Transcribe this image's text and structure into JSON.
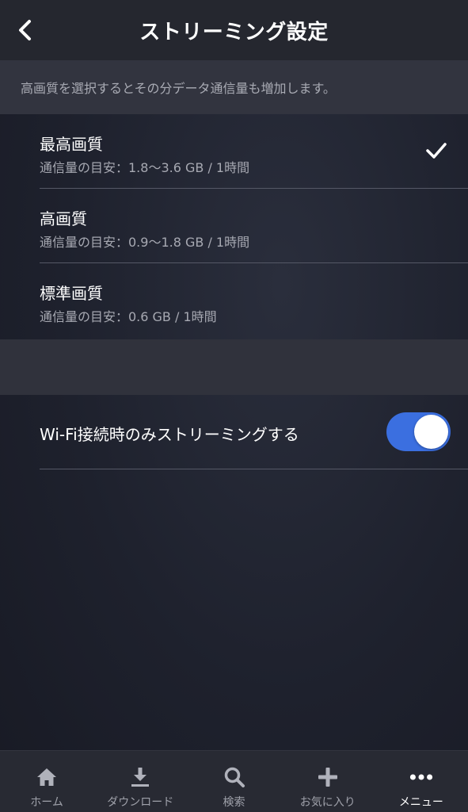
{
  "header": {
    "title": "ストリーミング設定",
    "back_icon": "chevron-left-icon"
  },
  "description": "高画質を選択するとその分データ通信量も増加します。",
  "quality_options": [
    {
      "title": "最高画質",
      "usage": "通信量の目安：1.8〜3.6 GB / 1時間",
      "selected": true
    },
    {
      "title": "高画質",
      "usage": "通信量の目安：0.9〜1.8 GB / 1時間",
      "selected": false
    },
    {
      "title": "標準画質",
      "usage": "通信量の目安：0.6 GB / 1時間",
      "selected": false
    }
  ],
  "wifi_only": {
    "label": "Wi-Fi接続時のみストリーミングする",
    "enabled": true,
    "toggle_color": "#3b6fe0"
  },
  "tabbar": {
    "items": [
      {
        "label": "ホーム",
        "icon": "home-icon",
        "active": false
      },
      {
        "label": "ダウンロード",
        "icon": "download-icon",
        "active": false
      },
      {
        "label": "検索",
        "icon": "search-icon",
        "active": false
      },
      {
        "label": "お気に入り",
        "icon": "plus-icon",
        "active": false
      },
      {
        "label": "メニュー",
        "icon": "more-dots-icon",
        "active": true
      }
    ]
  }
}
